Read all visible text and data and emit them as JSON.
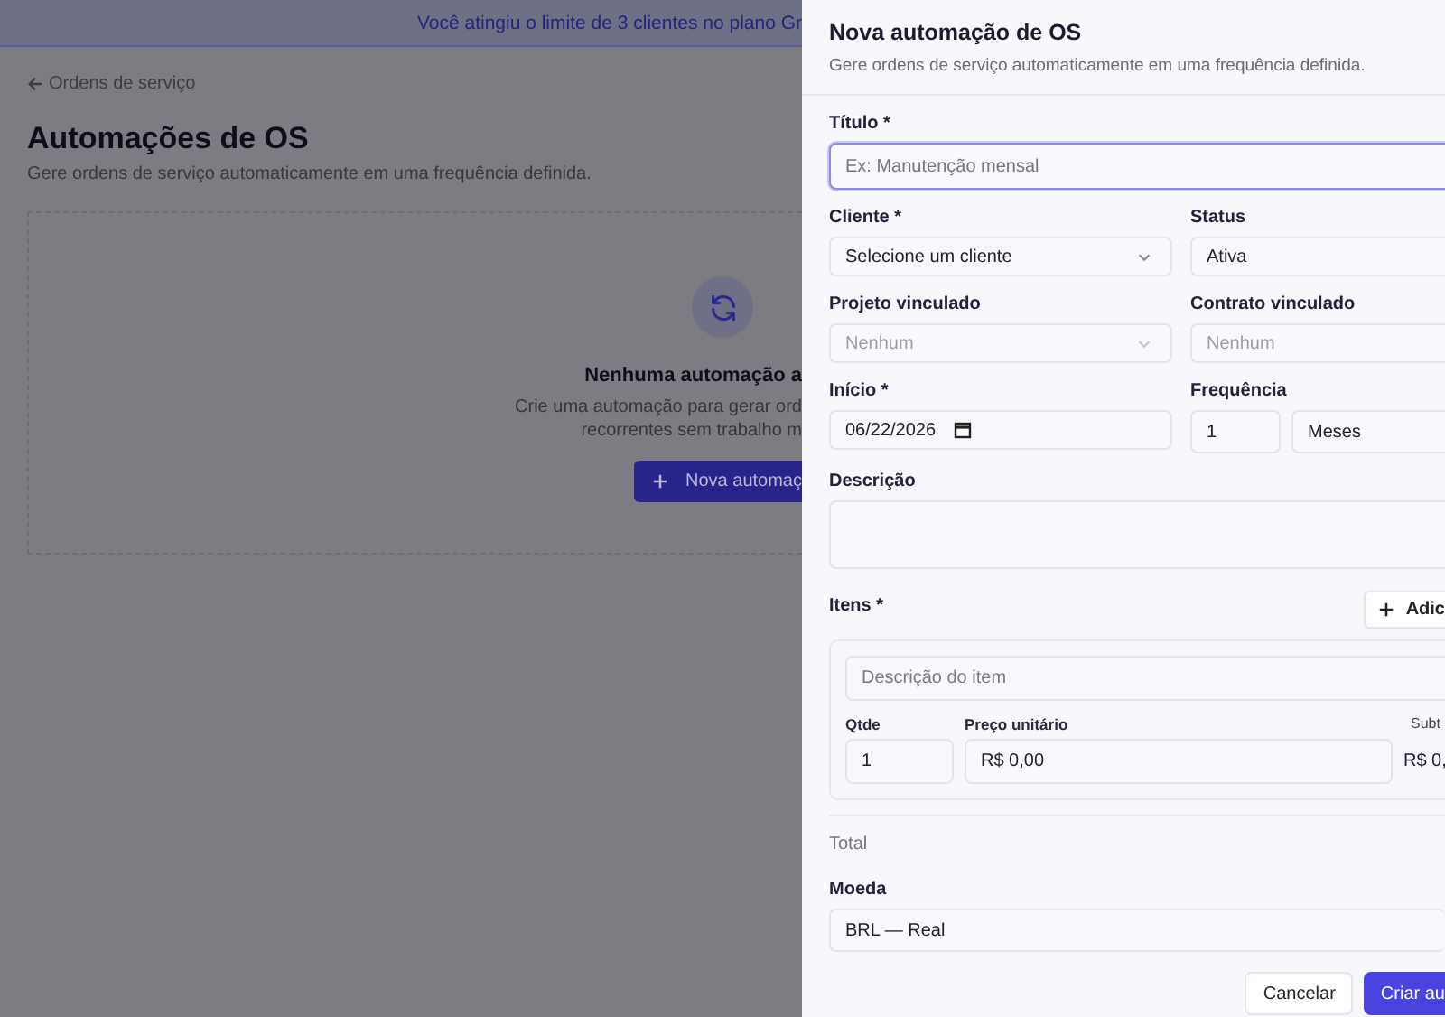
{
  "page": {
    "banner": "Você atingiu o limite de 3 clientes no plano Gr",
    "back_link": "Ordens de serviço",
    "title": "Automações de OS",
    "subtitle": "Gere ordens de serviço automaticamente em uma frequência definida.",
    "empty_state": {
      "title": "Nenhuma automação a",
      "description_lines": [
        "Crie uma automação para gerar ord",
        "recorrentes sem trabalho m"
      ],
      "button": "Nova automaç"
    }
  },
  "dialog": {
    "title": "Nova automação de OS",
    "subtitle": "Gere ordens de serviço automaticamente em uma frequência definida.",
    "rows": [
      {
        "fields": [
          {
            "kind": "input",
            "label": "Título *",
            "placeholder": "Ex: Manutenção mensal",
            "focused": true
          }
        ]
      },
      {
        "fields": [
          {
            "kind": "select",
            "label": "Cliente *",
            "value": "Selecione um cliente",
            "disabled": false
          },
          {
            "kind": "select",
            "label": "Status",
            "value": "Ativa",
            "disabled": false
          }
        ]
      },
      {
        "fields": [
          {
            "kind": "select",
            "label": "Projeto vinculado",
            "value": "Nenhum",
            "disabled": true
          },
          {
            "kind": "select",
            "label": "Contrato vinculado",
            "value": "Nenhum",
            "disabled": true
          }
        ]
      },
      {
        "fields": [
          {
            "kind": "date",
            "label": "Início *",
            "value": "06/22/2026",
            "disabled": false
          },
          {
            "kind": "frequency",
            "label": "Frequência",
            "value": "1",
            "unit": "Meses"
          }
        ]
      },
      {
        "fields": [
          {
            "kind": "textarea",
            "label": "Descrição"
          }
        ]
      }
    ],
    "items": {
      "label": "Itens *",
      "add_button": "Adic",
      "rows": [
        {
          "description_placeholder": "Descrição do item",
          "qty_label": "Qtde",
          "qty": "1",
          "price_label": "Preço unitário",
          "price": "R$ 0,00",
          "subtotal_label": "Subt",
          "subtotal": "R$ 0,"
        }
      ]
    },
    "total_label": "Total",
    "currency": {
      "label": "Moeda",
      "value": "BRL — Real"
    },
    "buttons": [
      {
        "kind": "secondary",
        "label": "Cancelar"
      },
      {
        "kind": "primary",
        "label": "Criar au"
      }
    ]
  }
}
